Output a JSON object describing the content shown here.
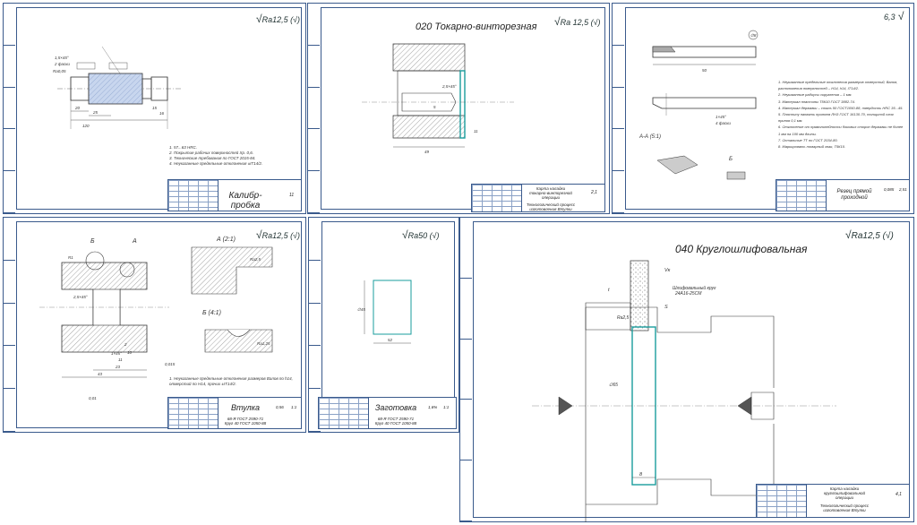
{
  "sheets": {
    "gauge": {
      "roughness": "Ra12,5",
      "title": "Калибр-пробка",
      "sheets_count": "11",
      "notes": [
        "1. 57...63 HRC.",
        "2. Покрытие рабочих поверхностей Хр. 0,6.",
        "3. Технические требования по ГОСТ 2015-84.",
        "4. Неуказанные предельные отклонения ±IT14/2."
      ],
      "dims": {
        "l120": "120",
        "d20": "20",
        "d25": "25",
        "d15": "15",
        "d16": "16",
        "rough16": "Ra0,05",
        "chamfer": "1,5×45°",
        "flats": "2 фаски"
      }
    },
    "turning": {
      "roughness": "Ra 12,5",
      "heading": "020 Токарно-винторезная",
      "stamp_line1": "Карта наладки",
      "stamp_line2": "токарно-винторезной",
      "stamp_line3": "операции",
      "process1": "Технологический процесс",
      "process2": "изготовления Втулки",
      "sheets_count": "2,1",
      "dims": {
        "l49": "49",
        "l5": "5",
        "l11": "11",
        "chamfer": "2,5×45°"
      }
    },
    "cutter": {
      "roughness": "6,3",
      "title_line1": "Резец прямой",
      "title_line2": "проходной",
      "scale": "0,085",
      "sheets_count": "2,51",
      "section": "А-А (5:1)",
      "view": "Б",
      "dims": {
        "l50": "50",
        "chamfer": "1×45°",
        "faces": "4 фаски",
        "circle": "∅8"
      },
      "notes": [
        "1. Неуказанные предельные отклонения размеров отверстий, Валов, расположения поверхностей – Н14, h14, IT14/2.",
        "2. Неуказанные радиусы скругления – 1 мм.",
        "3. Материал пластины Т5К10 ГОСТ 3882-74.",
        "4. Материал державки – сталь 50 ГОСТ1050-88, твердость HRC 35...45.",
        "5. Пластину напаять припоем ЛНЗ ГОСТ 16130-70, толщиной слоя припоя 0,1 мм.",
        "6. Отклонение от прямолинейности боковых сторон державки не более 1 мм на 100 мм длины.",
        "7. Остальные ТТ по ГОСТ 2034-80.",
        "8. Маркировать товарный знак, Т5К10."
      ]
    },
    "bushing": {
      "roughness": "Ra12,5",
      "title": "Втулка",
      "material1": "68-Я ГОСТ 2590-71",
      "material2": "Круг 40 ГОСТ 1050-88",
      "scale": "0,56",
      "sheets_count": "1:1",
      "detailA": "А (2:1)",
      "detailB": "Б (4:1)",
      "labelA": "А",
      "labelB": "Б",
      "note": "1. Неуказанные предельные отклонения размеров Валов по h14, отверстий по Н14, прочих ±IT14/2.",
      "dims": {
        "l23": "23",
        "l43": "43",
        "l11": "11",
        "l10": "10",
        "l2": "2",
        "r1": "R1",
        "chamfer": "2,5×45°",
        "chamfer2": "1×45°",
        "tol1": "0,01",
        "tol2": "0,015",
        "roughA": "Ra2,5",
        "roughB": "Ra1,25"
      }
    },
    "blank": {
      "roughness": "Ra50",
      "title": "Заготовка",
      "material1": "68-Я ГОСТ 2590-71",
      "material2": "Круг 40 ГОСТ 1050-88",
      "scale": "1,6%",
      "sheets_count": "1:1",
      "dims": {
        "d": "∅45",
        "l": "52"
      }
    },
    "grinding": {
      "roughness": "Ra12,5",
      "heading": "040 Круглошлифовальная",
      "wheel_label1": "Шлифовальный круг",
      "wheel_label2": "24А16-25СМ",
      "stamp_line1": "Карта наладки",
      "stamp_line2": "круглошлифовальной",
      "stamp_line3": "операции",
      "process1": "Технологический процесс",
      "process2": "изготовления Втулки",
      "sheets_count": "4,1",
      "dims": {
        "vk": "Vк",
        "s": "S",
        "t": "t",
        "l8": "8",
        "d65": "∅65",
        "rough": "Ra2,5"
      }
    }
  },
  "colors": {
    "frame": "#3a5a8c",
    "cyan": "#1a9c9c",
    "hatch": "#777777"
  }
}
